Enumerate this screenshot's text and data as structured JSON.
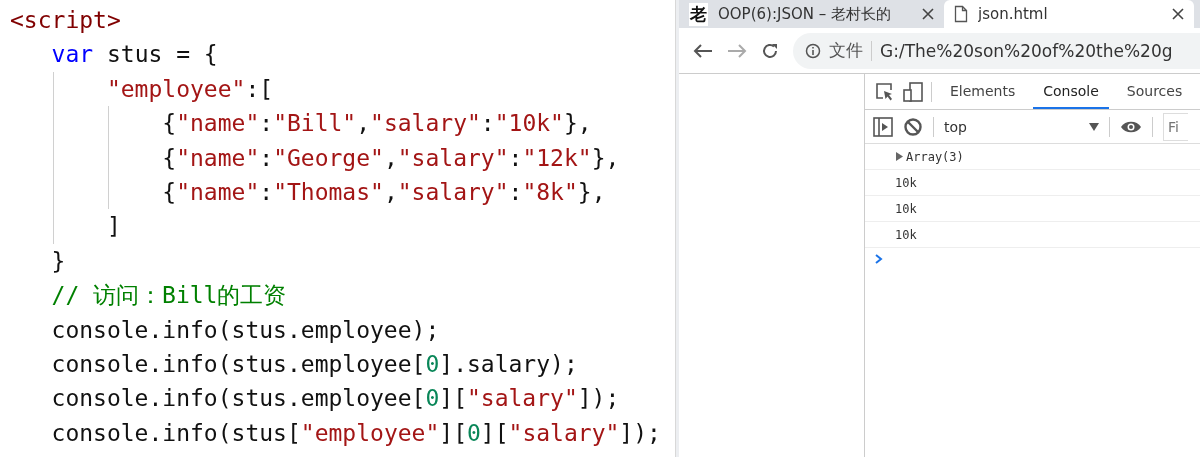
{
  "editor": {
    "lines": [
      {
        "tokens": [
          {
            "kind": "tag",
            "text": "<script>"
          }
        ]
      },
      {
        "tokens": [
          {
            "kind": "keyword",
            "text": "   var"
          },
          {
            "kind": "plain",
            "text": " stus = {"
          }
        ]
      },
      {
        "tokens": [
          {
            "kind": "string",
            "text": "       \"employee\""
          },
          {
            "kind": "plain",
            "text": ":["
          }
        ]
      },
      {
        "tokens": [
          {
            "kind": "plain",
            "text": "           {"
          },
          {
            "kind": "string",
            "text": "\"name\""
          },
          {
            "kind": "plain",
            "text": ":"
          },
          {
            "kind": "string",
            "text": "\"Bill\""
          },
          {
            "kind": "plain",
            "text": ","
          },
          {
            "kind": "string",
            "text": "\"salary\""
          },
          {
            "kind": "plain",
            "text": ":"
          },
          {
            "kind": "string",
            "text": "\"10k\""
          },
          {
            "kind": "plain",
            "text": "},"
          }
        ]
      },
      {
        "tokens": [
          {
            "kind": "plain",
            "text": "           {"
          },
          {
            "kind": "string",
            "text": "\"name\""
          },
          {
            "kind": "plain",
            "text": ":"
          },
          {
            "kind": "string",
            "text": "\"George\""
          },
          {
            "kind": "plain",
            "text": ","
          },
          {
            "kind": "string",
            "text": "\"salary\""
          },
          {
            "kind": "plain",
            "text": ":"
          },
          {
            "kind": "string",
            "text": "\"12k\""
          },
          {
            "kind": "plain",
            "text": "},"
          }
        ]
      },
      {
        "tokens": [
          {
            "kind": "plain",
            "text": "           {"
          },
          {
            "kind": "string",
            "text": "\"name\""
          },
          {
            "kind": "plain",
            "text": ":"
          },
          {
            "kind": "string",
            "text": "\"Thomas\""
          },
          {
            "kind": "plain",
            "text": ","
          },
          {
            "kind": "string",
            "text": "\"salary\""
          },
          {
            "kind": "plain",
            "text": ":"
          },
          {
            "kind": "string",
            "text": "\"8k\""
          },
          {
            "kind": "plain",
            "text": "},"
          }
        ]
      },
      {
        "tokens": [
          {
            "kind": "plain",
            "text": "       ]"
          }
        ]
      },
      {
        "tokens": [
          {
            "kind": "plain",
            "text": "   }"
          }
        ]
      },
      {
        "tokens": [
          {
            "kind": "comment",
            "text": "   // 访问：Bill的工资"
          }
        ]
      },
      {
        "tokens": [
          {
            "kind": "plain",
            "text": "   console.info(stus.employee);"
          }
        ]
      },
      {
        "tokens": [
          {
            "kind": "plain",
            "text": "   console.info(stus.employee["
          },
          {
            "kind": "number",
            "text": "0"
          },
          {
            "kind": "plain",
            "text": "].salary);"
          }
        ]
      },
      {
        "tokens": [
          {
            "kind": "plain",
            "text": "   console.info(stus.employee["
          },
          {
            "kind": "number",
            "text": "0"
          },
          {
            "kind": "plain",
            "text": "]["
          },
          {
            "kind": "string",
            "text": "\"salary\""
          },
          {
            "kind": "plain",
            "text": "]);"
          }
        ]
      },
      {
        "tokens": [
          {
            "kind": "plain",
            "text": "   console.info(stus["
          },
          {
            "kind": "string",
            "text": "\"employee\""
          },
          {
            "kind": "plain",
            "text": "]["
          },
          {
            "kind": "number",
            "text": "0"
          },
          {
            "kind": "plain",
            "text": "]["
          },
          {
            "kind": "string",
            "text": "\"salary\""
          },
          {
            "kind": "plain",
            "text": "]);"
          }
        ]
      }
    ]
  },
  "browser": {
    "tabs": [
      {
        "favicon": "老",
        "title": "OOP(6):JSON – 老村长的",
        "selected": false
      },
      {
        "title": "json.html",
        "selected": true
      }
    ],
    "address": {
      "scheme": "文件",
      "url": "G:/The%20son%20of%20the%20g"
    },
    "devtools": {
      "tabs": [
        {
          "label": "Elements",
          "selected": false
        },
        {
          "label": "Console",
          "selected": true
        },
        {
          "label": "Sources",
          "selected": false
        }
      ],
      "context": "top",
      "filter_placeholder": "Fi",
      "messages": [
        {
          "kind": "object",
          "text": "Array(3)",
          "expanded": false
        },
        {
          "kind": "value",
          "text": "10k"
        },
        {
          "kind": "value",
          "text": "10k"
        },
        {
          "kind": "value",
          "text": "10k"
        }
      ]
    }
  }
}
